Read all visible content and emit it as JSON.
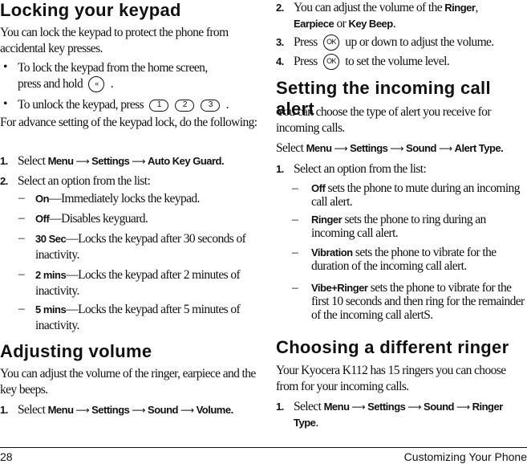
{
  "left": {
    "section1": {
      "heading": "Locking your keypad",
      "intro": "You can lock the keypad to protect the phone from accidental key presses.",
      "bullets": [
        {
          "text_a": "To lock the keypad from the home screen,",
          "text_b": "press and hold",
          "key": "«",
          "end": "."
        },
        {
          "text": "To unlock the keypad, press",
          "keys": [
            "1",
            "2",
            "3"
          ],
          "end": "."
        }
      ],
      "advance": "For advance setting of the keypad lock, do the following:",
      "steps": [
        {
          "num": "1.",
          "prefix": "Select",
          "path": [
            "Menu",
            "Settings",
            "Auto Key Guard."
          ]
        },
        {
          "num": "2.",
          "text": "Select an option from the list:"
        }
      ],
      "options": [
        {
          "label": "On",
          "desc": "—Immediately locks the keypad."
        },
        {
          "label": "Off",
          "desc": "—Disables keyguard."
        },
        {
          "label": "30 Sec",
          "desc": "—Locks the keypad after 30 seconds of inactivity."
        },
        {
          "label": "2 mins",
          "desc": "—Locks the keypad after 2 minutes of inactivity."
        },
        {
          "label": "5 mins",
          "desc": "—Locks the keypad after 5 minutes of inactivity."
        }
      ]
    },
    "section2": {
      "heading": "Adjusting volume",
      "intro": "You can adjust the volume of the ringer, earpiece and the key beeps.",
      "step1": {
        "num": "1.",
        "prefix": "Select",
        "path": [
          "Menu",
          "Settings",
          "Sound",
          "Volume."
        ]
      }
    }
  },
  "right": {
    "volume_steps": [
      {
        "num": "2.",
        "a": "You can adjust the volume of the ",
        "b1": "Ringer",
        "c": ",",
        "b2": "Earpiece",
        "d": " or ",
        "b3": "Key Beep",
        "e": "."
      },
      {
        "num": "3.",
        "a": "Press",
        "key": "OK",
        "b": "up or down to adjust the volume."
      },
      {
        "num": "4.",
        "a": "Press",
        "key": "OK",
        "b": "to set the volume level."
      }
    ],
    "section3": {
      "heading": "Setting the incoming call alert",
      "intro": "You can choose the type of alert you receive for incoming calls.",
      "select_prefix": "Select",
      "path": [
        "Menu",
        "Settings",
        "Sound",
        "Alert Type."
      ],
      "step1": {
        "num": "1.",
        "text": "Select an option from the list:"
      },
      "options": [
        {
          "label": "Off",
          "desc": " sets the phone to mute during an incoming call alert."
        },
        {
          "label": "Ringer",
          "desc": " sets the phone to ring during an incoming call alert."
        },
        {
          "label": "Vibration",
          "desc": " sets the phone to vibrate for the duration of the incoming call alert."
        },
        {
          "label": "Vibe+Ringer",
          "desc": " sets the phone to vibrate for the first 10 seconds and then ring for the remainder of the incoming call alertS."
        }
      ]
    },
    "section4": {
      "heading": "Choosing a different ringer",
      "intro": "Your Kyocera K112 has 15 ringers you can choose from for your incoming calls.",
      "step1": {
        "num": "1.",
        "prefix": "Select",
        "path": [
          "Menu",
          "Settings",
          "Sound",
          "Ringer Type"
        ],
        "end": "."
      }
    }
  },
  "footer": {
    "page_number": "28",
    "chapter": "Customizing Your Phone"
  },
  "arrow_glyph": "⟶"
}
